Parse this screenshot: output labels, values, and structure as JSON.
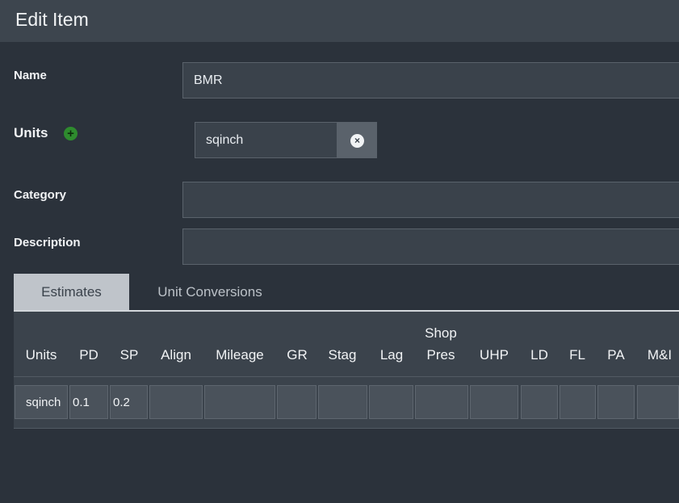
{
  "header": {
    "title": "Edit Item"
  },
  "form": {
    "name_label": "Name",
    "name_value": "BMR",
    "units_label": "Units",
    "units_value": "sqinch",
    "category_label": "Category",
    "category_value": "",
    "description_label": "Description",
    "description_value": ""
  },
  "tabs": [
    {
      "label": "Estimates",
      "active": true
    },
    {
      "label": "Unit Conversions",
      "active": false
    }
  ],
  "table": {
    "columns": [
      "Units",
      "PD",
      "SP",
      "Align",
      "Mileage",
      "GR",
      "Stag",
      "Lag",
      "Shop Pres",
      "UHP",
      "LD",
      "FL",
      "PA",
      "M&I"
    ],
    "row": [
      "sqinch",
      "0.1",
      "0.2",
      "",
      "",
      "",
      "",
      "",
      "",
      "",
      "",
      "",
      "",
      ""
    ]
  },
  "icons": {
    "add_unit": "plus-circle-icon",
    "clear_unit": "clear-x-icon"
  },
  "colors": {
    "background": "#2b323b",
    "header": "#3d454e",
    "add_icon": "#2e8b2e",
    "active_tab": "#bfc4ca"
  }
}
